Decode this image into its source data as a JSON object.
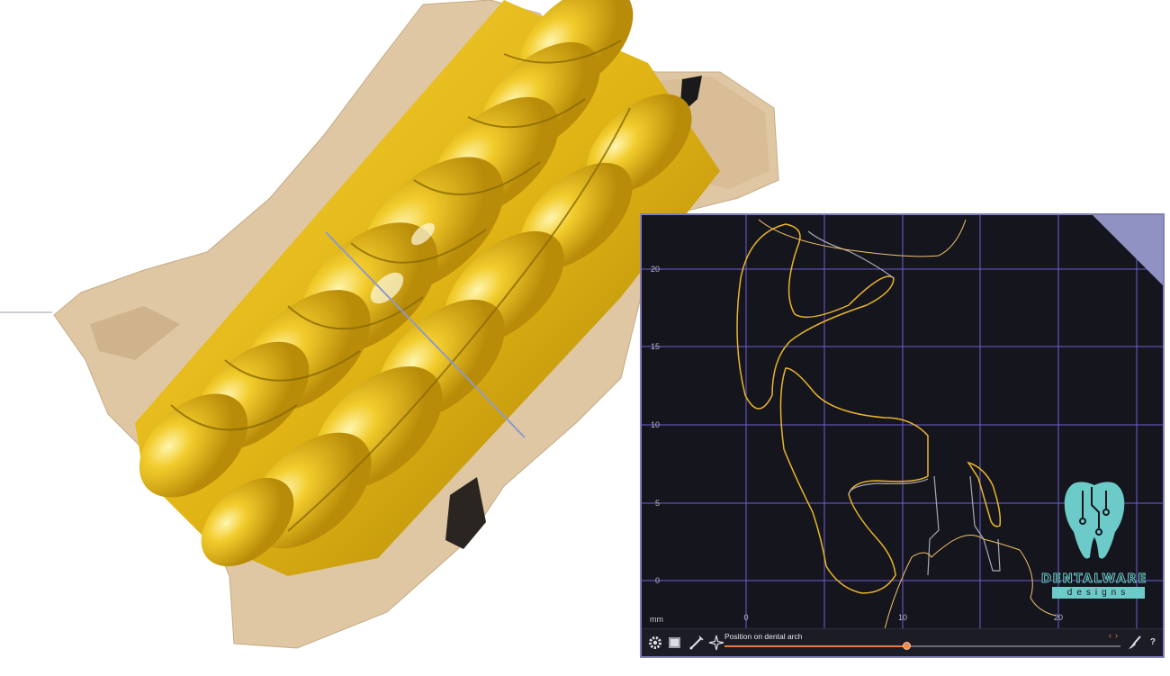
{
  "section_view": {
    "unit_label": "mm",
    "x_ticks": [
      "0",
      "10",
      "20"
    ],
    "y_ticks": [
      "20",
      "15",
      "10",
      "5",
      "0"
    ]
  },
  "toolbar": {
    "slider_label": "Position on dental arch",
    "slider_value_fraction": 0.46,
    "prev_label": "‹",
    "next_label": "›",
    "help_label": "?"
  },
  "brand": {
    "name": "DENTALWARE",
    "sub": "designs"
  },
  "colors": {
    "tooth_gold": "#e0b414",
    "gingiva": "#dfc7a4",
    "panel_bg": "#15151d",
    "panel_border": "#7f80b6",
    "grid": "#6e5fd4",
    "outline_yellow": "#e9b52a",
    "outline_gray": "#a8aab8",
    "accent_orange": "#e97a3a",
    "brand_teal": "#6ccbc9"
  },
  "icons": {
    "toolbar": [
      "gear-icon",
      "view-cube-icon",
      "measure-icon",
      "snap-point-icon",
      "brush-icon"
    ]
  }
}
